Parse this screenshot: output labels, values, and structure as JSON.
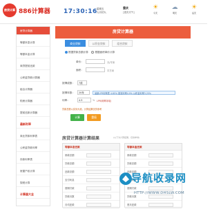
{
  "header": {
    "logo_badge": "房贷计算",
    "site_name": "886计算器",
    "time": "17:30:16",
    "date_line1": "星期五",
    "date_line2": "九月初九",
    "weather_city": "重庆",
    "weather_note": "[重庆天气]",
    "weather": [
      {
        "glyph": "☀",
        "label": "今天"
      },
      {
        "glyph": "☁",
        "label": "明天"
      },
      {
        "glyph": "☀",
        "label": "后天"
      }
    ]
  },
  "sidebar": {
    "items": [
      {
        "label": "房贷计算器",
        "style": "active"
      },
      {
        "label": "等额本息计算",
        "style": ""
      },
      {
        "label": "等额本金计算",
        "style": ""
      },
      {
        "label": "商贷提前还款",
        "style": ""
      },
      {
        "label": "公积金贷款计算器",
        "style": ""
      },
      {
        "label": "组合计算器",
        "style": ""
      },
      {
        "label": "购房计算器",
        "style": ""
      },
      {
        "label": "提前还款计算器",
        "style": ""
      },
      {
        "label": "最新利率",
        "style": "red"
      },
      {
        "label": "商业贷款利率表",
        "style": ""
      },
      {
        "label": "公积金贷款利率",
        "style": ""
      },
      {
        "label": "存款利率表",
        "style": ""
      },
      {
        "label": "房屋产权计算",
        "style": ""
      },
      {
        "label": "契税计算",
        "style": ""
      },
      {
        "label": "计算器大全",
        "style": "red"
      }
    ]
  },
  "main": {
    "title": "房贷计算器",
    "tabs": [
      "商业贷款",
      "公积金贷款",
      "组合贷款"
    ],
    "calc_mode": {
      "option1": "根据贷款总额计算",
      "option2": "根据面积单价计算"
    },
    "fields": {
      "price_label": "单价：",
      "price_unit": "元/平米",
      "area_label": "面积：",
      "area_unit": "平方米",
      "ratio_label": "按揭成数：",
      "ratio_value": "7成",
      "years_label": "按揭年数：",
      "years_value": "20年",
      "rate_note": "最新LPR利率表 4.65% 基准利率4.9% 公积金利率3.25%",
      "rate_label": "利率：",
      "rate_value": "4.9",
      "rate_unit": "%",
      "rate_tip": "LPR(利率浮动)",
      "loan_note": "贷款总额以实际为准，计算结果仅供参考"
    },
    "buttons": {
      "calculate": "计算",
      "reset": "重填"
    },
    "result": {
      "title": "房贷计算器计算结果",
      "subtitle": "(以下为计算结果，仅供参考)",
      "panel_left": {
        "title": "等额本息还款",
        "rows": [
          "房款总额",
          "贷款总额",
          "还款总额",
          "支付利息",
          "首期付款",
          "贷款月数",
          "月均还款"
        ]
      },
      "panel_right": {
        "title": "等额本金还款",
        "rows": [
          "房款总额",
          "贷款总额",
          "还款总额",
          "支付利息",
          "首期付款",
          "贷款月数",
          "首月还款"
        ]
      }
    }
  },
  "watermark": {
    "main": "导航收录网",
    "url": "HTTP://WWW.DHSLW.COM"
  },
  "colors": {
    "brand_red": "#e53a2e",
    "banner": "#ec5d3d",
    "tab_blue": "#3a8de0",
    "btn_green": "#43b24a",
    "btn_orange": "#f29b21"
  }
}
